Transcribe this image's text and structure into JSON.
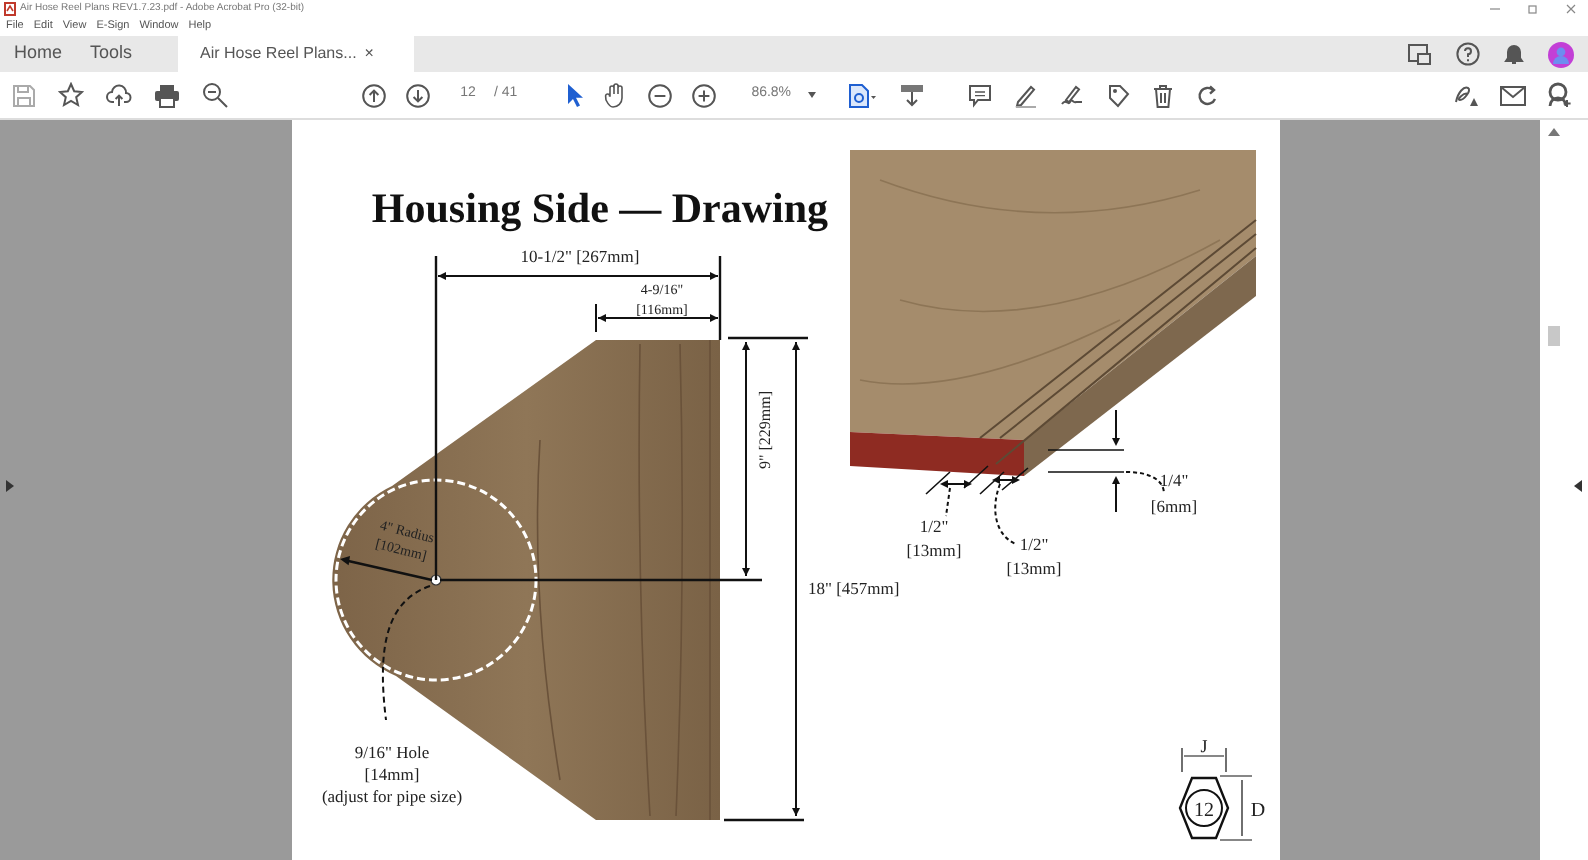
{
  "window": {
    "title": "Air Hose Reel Plans REV1.7.23.pdf - Adobe Acrobat Pro (32-bit)"
  },
  "menu": [
    "File",
    "Edit",
    "View",
    "E-Sign",
    "Window",
    "Help"
  ],
  "tabs": [
    {
      "label": "Home",
      "selected": false
    },
    {
      "label": "Tools",
      "selected": false
    },
    {
      "label": "Air Hose Reel Plans...",
      "selected": true,
      "close": "×"
    }
  ],
  "toolbar": {
    "page_number": "12",
    "page_total": "/ 41",
    "zoom": "86.8%"
  },
  "document": {
    "title": "Housing Side — Drawing",
    "labels": [
      "10-1/2\" [267mm]",
      "4-9/16\"",
      "[116mm]",
      "9\" [229mm]",
      "18\" [457mm]",
      "4\" Radius",
      "[102mm]",
      "9/16\" Hole",
      "[14mm]",
      "(adjust for pipe size)",
      "1/2\"",
      "[13mm]",
      "1/2\"",
      "[13mm]",
      "1/4\"",
      "[6mm]",
      "J",
      "D",
      "12"
    ]
  }
}
